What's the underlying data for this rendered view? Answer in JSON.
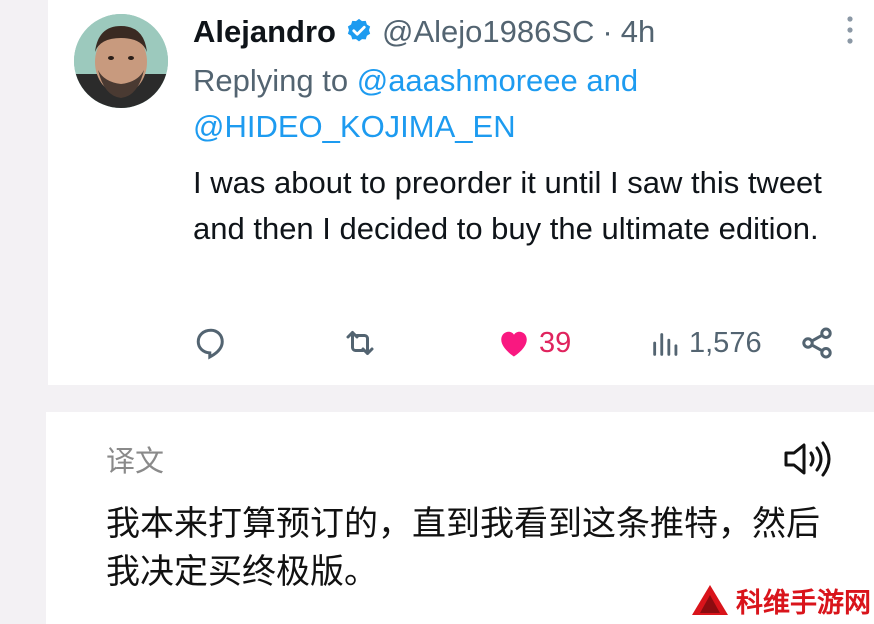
{
  "tweet": {
    "author_name": "Alejandro",
    "handle": "@Alejo1986SC",
    "separator": "·",
    "time": "4h",
    "replying_prefix": "Replying to",
    "mention_1": "@aaashmoreee",
    "conjunction": "and",
    "mention_2": "@HIDEO_KOJIMA_EN",
    "text": "I was about to preorder it until I saw this tweet and then I decided to buy the ultimate edition.",
    "actions": {
      "reply_icon": "reply-icon",
      "retweet_icon": "retweet-icon",
      "like_icon": "heart-icon",
      "likes": "39",
      "views_icon": "views-icon",
      "views": "1,576",
      "share_icon": "share-icon"
    },
    "colors": {
      "mention": "#1d9bf0",
      "like": "#e0245e",
      "verified": "#1d9bf0"
    }
  },
  "translation": {
    "label": "译文",
    "speaker_icon": "speaker-icon",
    "text": "我本来打算预订的，直到我看到这条推特，然后我决定买终极版。"
  },
  "watermark": {
    "text": "科维手游网"
  }
}
